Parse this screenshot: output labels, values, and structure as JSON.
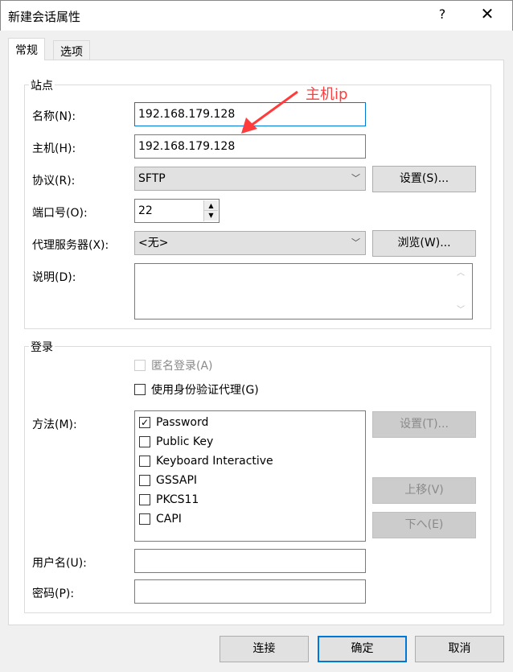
{
  "window": {
    "title": "新建会话属性",
    "help": "?",
    "close": "✕"
  },
  "tabs": [
    {
      "label": "常规",
      "active": true
    },
    {
      "label": "选项",
      "active": false
    }
  ],
  "site": {
    "group_label": "站点",
    "name_label": "名称(N):",
    "name_value": "192.168.179.128",
    "host_label": "主机(H):",
    "host_value": "192.168.179.128",
    "protocol_label": "协议(R):",
    "protocol_value": "SFTP",
    "protocol_settings": "设置(S)...",
    "port_label": "端口号(O):",
    "port_value": "22",
    "proxy_label": "代理服务器(X):",
    "proxy_value": "<无>",
    "proxy_browse": "浏览(W)...",
    "desc_label": "说明(D):",
    "desc_value": ""
  },
  "annotation": {
    "text": "主机ip",
    "color": "#ff3b3b"
  },
  "login": {
    "group_label": "登录",
    "anonymous": {
      "label": "匿名登录(A)",
      "checked": false,
      "disabled": true
    },
    "agent": {
      "label": "使用身份验证代理(G)",
      "checked": false
    },
    "method_label": "方法(M):",
    "methods": [
      {
        "label": "Password",
        "checked": true
      },
      {
        "label": "Public Key",
        "checked": false
      },
      {
        "label": "Keyboard Interactive",
        "checked": false
      },
      {
        "label": "GSSAPI",
        "checked": false
      },
      {
        "label": "PKCS11",
        "checked": false
      },
      {
        "label": "CAPI",
        "checked": false
      }
    ],
    "method_settings": "设置(T)...",
    "move_up": "上移(V)",
    "move_down": "下へ(E)",
    "username_label": "用户名(U):",
    "username_value": "",
    "password_label": "密码(P):",
    "password_value": ""
  },
  "footer": {
    "connect": "连接",
    "ok": "确定",
    "cancel": "取消"
  },
  "colors": {
    "accent": "#0078d7"
  }
}
